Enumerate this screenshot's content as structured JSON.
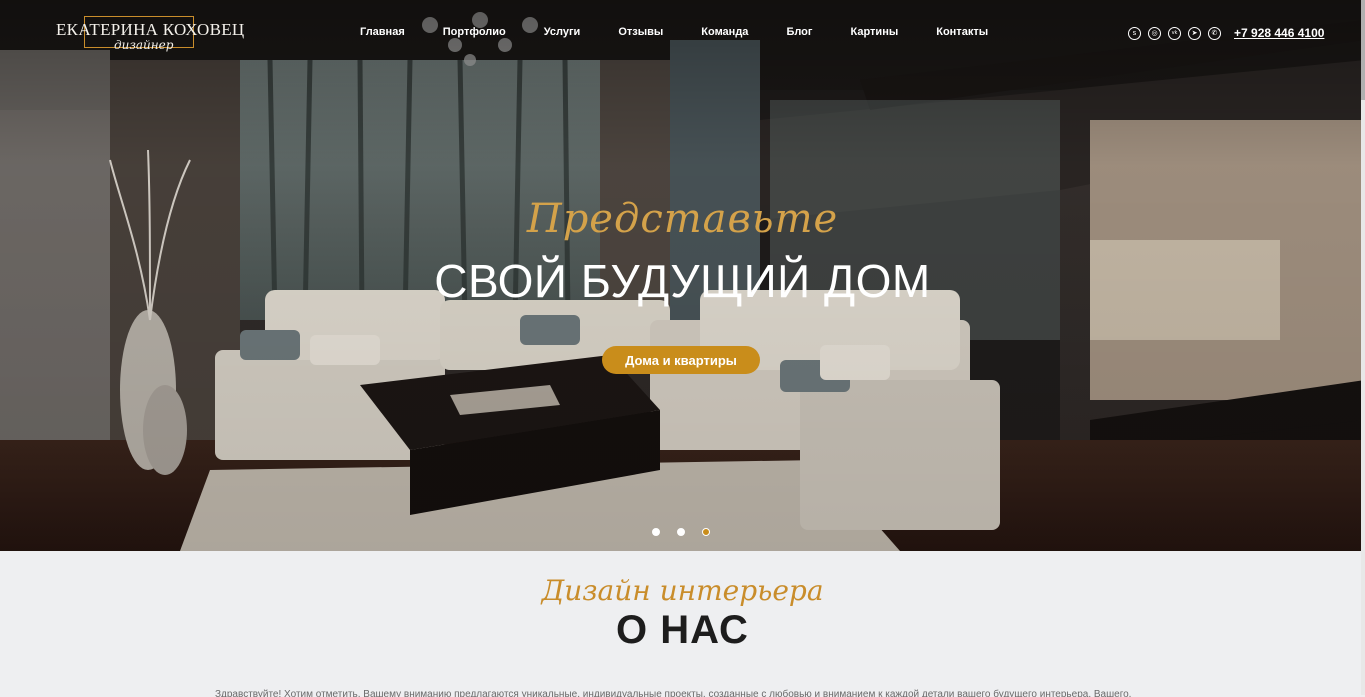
{
  "header": {
    "logo_name": "ЕКАТЕРИНА КОХОВЕЦ",
    "logo_subtitle": "дизайнер",
    "nav": [
      "Главная",
      "Портфолио",
      "Услуги",
      "Отзывы",
      "Команда",
      "Блог",
      "Картины",
      "Контакты"
    ],
    "social": [
      {
        "icon": "skype-icon",
        "glyph": "s"
      },
      {
        "icon": "instagram-icon",
        "glyph": "◎"
      },
      {
        "icon": "vk-icon",
        "glyph": "vk"
      },
      {
        "icon": "telegram-icon",
        "glyph": "➤"
      },
      {
        "icon": "whatsapp-icon",
        "glyph": "✆"
      }
    ],
    "phone": "+7 928 446 4100"
  },
  "hero": {
    "script": "Представьте",
    "title": "СВОЙ БУДУЩИЙ ДОМ",
    "button": "Дома и квартиры",
    "slides_total": 3,
    "active_slide": 3
  },
  "about": {
    "script": "Дизайн интерьера",
    "title": "О НАС",
    "text": "Здравствуйте! Хотим отметить, Вашему вниманию предлагаются уникальные, индивидуальные проекты, созданные с любовью и вниманием к каждой детали вашего будущего интерьера. Вашего."
  },
  "colors": {
    "accent": "#c98d1b",
    "script_gold": "#d4a24a",
    "about_bg": "#eeeff1"
  }
}
